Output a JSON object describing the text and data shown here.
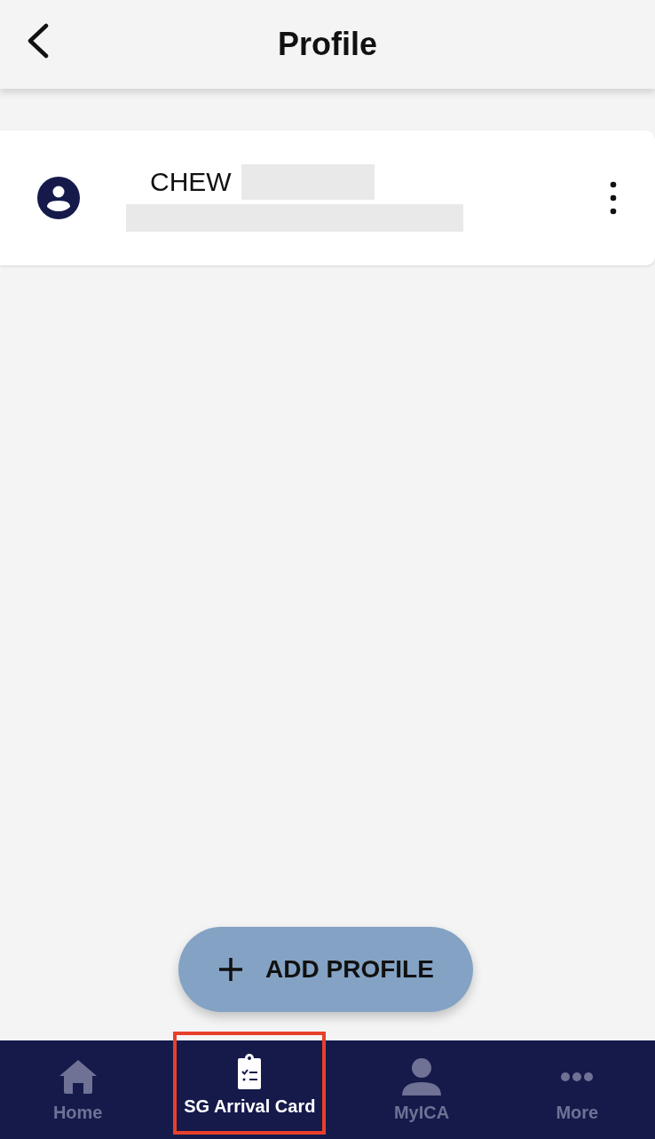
{
  "header": {
    "title": "Profile"
  },
  "profiles": [
    {
      "name": "CHEW"
    }
  ],
  "add_button": {
    "label": "ADD PROFILE"
  },
  "tabs": [
    {
      "label": "Home",
      "kind": "home",
      "selected": false,
      "highlighted": false
    },
    {
      "label": "SG Arrival Card",
      "kind": "clipboard",
      "selected": true,
      "highlighted": true
    },
    {
      "label": "MyICA",
      "kind": "person",
      "selected": false,
      "highlighted": false
    },
    {
      "label": "More",
      "kind": "dots",
      "selected": false,
      "highlighted": false
    }
  ]
}
